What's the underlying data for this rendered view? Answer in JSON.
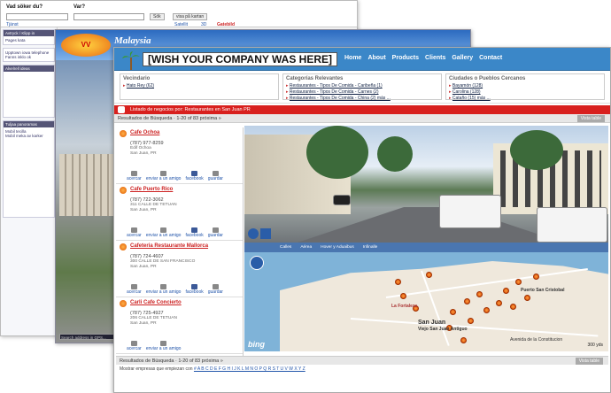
{
  "win1": {
    "q1": "Vad söker du?",
    "q2": "Var?",
    "search_btn": "Sök",
    "map_btn": "visa på kartan",
    "links": [
      "Tjänst",
      "Satellit",
      "3D"
    ],
    "logo": "Gatebild",
    "side_heads": [
      "Avtryck / Klipp in",
      "Alvelrell ideas",
      "Tuljaa panoramas"
    ],
    "side_items": [
      "Pages kata",
      "Upptown iowa telephone",
      "Fanns inklo ok",
      "Mobil tecilla",
      "Mobil meka av karker"
    ]
  },
  "win2": {
    "logo_text": "VV",
    "brand": "Malaysia",
    "caption": "Search address in GPS..."
  },
  "win3": {
    "banner": "[WISH YOUR COMPANY WAS HERE]",
    "menu": [
      "Home",
      "About",
      "Products",
      "Clients",
      "Gallery",
      "Contact"
    ],
    "box1_title": "Vecindario",
    "box1_items": [
      "Hato Rey (62)"
    ],
    "box2_title": "Categorías Relevantes",
    "box2_items": [
      "Restaurantes - Tipos De Comida - Caribeña (1)",
      "Restaurantes - Tipos De Comida - Carnes (2)",
      "Restaurantes - Tipos De Comida - China (2) más ..."
    ],
    "box3_title": "Ciudades o Pueblos Cercanos",
    "box3_items": [
      "Bayamón (128)",
      "Carolina (128)",
      "Cataño (15) más ..."
    ],
    "red_bar": "Listado de negocios por: Restaurantes en San Juan PR",
    "results_header": "Resultados de Búsqueda · 1-20 of 83 próxima »",
    "results_tag": "Vista table",
    "footer_results": "Resultados de Búsqueda · 1-20 of 83 próxima »",
    "alpha_label": "Mostrar empresas que empiezan con",
    "alpha": "# A B C D E F G H I J K L M N O P Q R S T U V W X Y Z",
    "listings": [
      {
        "name": "Cafe Ochoa",
        "phone": "(787) 977-8259",
        "addr1": "Edif Ochoa",
        "addr2": "San Juan, PR"
      },
      {
        "name": "Cafe Puerto Rico",
        "phone": "(787) 722-3062",
        "addr1": "311 CALLE DE TETUAN",
        "addr2": "San Juan, PR"
      },
      {
        "name": "Cafeteria Restaurante Mallorca",
        "phone": "(787) 724-4607",
        "addr1": "300 CALLE DE SAN FRANCISCO",
        "addr2": "San Juan, PR"
      },
      {
        "name": "Carli Cafe Concierto",
        "phone": "(787) 725-4927",
        "addr1": "206 CALLE DE TETUAN",
        "addr2": "San Juan, PR"
      }
    ],
    "actions": [
      "acercar",
      "enviar a un amigo",
      "facebook",
      "guardar"
    ],
    "map_tabs": [
      "Calles",
      "Aérea",
      "Hover y Aduaibus",
      "Infinalle"
    ],
    "map_labels": [
      "Puerto San Cristobal",
      "Viejo San Juan Antiguo",
      "San Juan",
      "La Fortaleza",
      "Avenida de la Constitucion"
    ],
    "bing": "bing",
    "scale": "300 yds"
  }
}
